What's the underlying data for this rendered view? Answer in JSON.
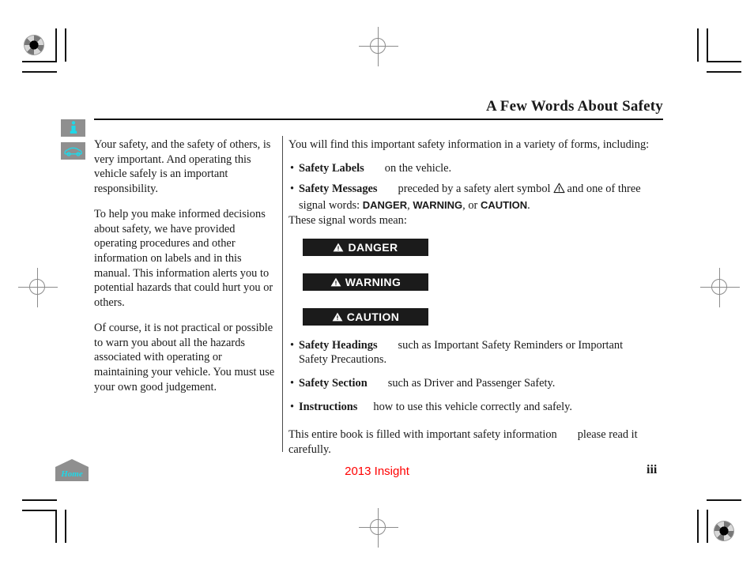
{
  "header": {
    "title": "A Few Words About Safety"
  },
  "margin_icons": [
    {
      "name": "info-icon",
      "glyph": "i"
    },
    {
      "name": "vehicle-icon",
      "glyph": "car"
    }
  ],
  "left_column": {
    "paragraphs": [
      "Your safety, and the safety of others, is very important. And operating this vehicle safely is an important responsibility.",
      "To help you make informed decisions about safety, we have provided operating procedures and other information on labels and in this manual. This information alerts you to potential hazards that could hurt you or others.",
      "Of course, it is not practical or possible to warn you about all the hazards associated with operating or maintaining your vehicle. You must use your own good judgement."
    ]
  },
  "right_column": {
    "intro": "You will find this important safety information in a variety of forms, including:",
    "bullets": [
      {
        "term": "Safety Labels",
        "description": "on the vehicle."
      },
      {
        "term": "Safety Messages",
        "description_before_symbol": "preceded by a safety alert symbol",
        "description_after_symbol": "and one of three signal words:",
        "signal_words": [
          "DANGER",
          "WARNING",
          "CAUTION"
        ],
        "separator_1": ", ",
        "separator_2": ", or ",
        "terminator": "."
      }
    ],
    "these_signal_words_mean": "These signal words mean:",
    "banners": [
      {
        "label": "DANGER",
        "icon": "warning-triangle-icon"
      },
      {
        "label": "WARNING",
        "icon": "warning-triangle-icon"
      },
      {
        "label": "CAUTION",
        "icon": "warning-triangle-icon"
      }
    ],
    "bullets_2": [
      {
        "term": "Safety Headings",
        "description": "such as Important Safety Reminders or Important Safety Precautions."
      },
      {
        "term": "Safety Section",
        "description": "such as Driver and Passenger Safety."
      },
      {
        "term": "Instructions",
        "description": "how to use this vehicle correctly and safely."
      }
    ],
    "closing_part_1": "This entire book is filled with important safety information",
    "closing_part_2": "please read it carefully."
  },
  "footer": {
    "home_button_label": "Home",
    "model": "2013 Insight",
    "page_number": "iii"
  },
  "colors": {
    "banner_background": "#1b1b1b",
    "banner_text": "#ffffff",
    "icon_background": "#8f8f8f",
    "icon_accent": "#1fd8e8",
    "model_text": "#ff0000"
  }
}
